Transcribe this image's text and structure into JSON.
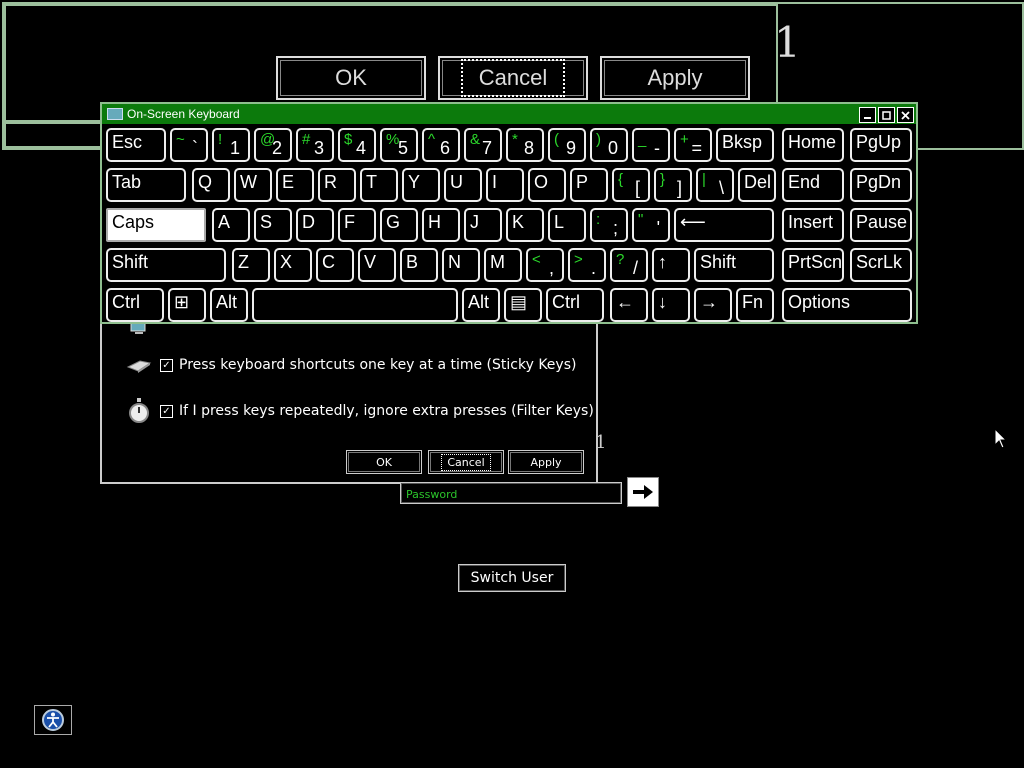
{
  "magnified_dialog": {
    "digit": "1",
    "ok_label": "OK",
    "cancel_label": "Cancel",
    "apply_label": "Apply"
  },
  "osk": {
    "title": "On-Screen Keyboard",
    "rows": [
      [
        {
          "id": "esc",
          "label": "Esc"
        },
        {
          "id": "backtick",
          "shift": "~",
          "base": "`"
        },
        {
          "id": "1",
          "shift": "!",
          "base": "1"
        },
        {
          "id": "2",
          "shift": "@",
          "base": "2"
        },
        {
          "id": "3",
          "shift": "#",
          "base": "3"
        },
        {
          "id": "4",
          "shift": "$",
          "base": "4"
        },
        {
          "id": "5",
          "shift": "%",
          "base": "5"
        },
        {
          "id": "6",
          "shift": "^",
          "base": "6"
        },
        {
          "id": "7",
          "shift": "&",
          "base": "7"
        },
        {
          "id": "8",
          "shift": "*",
          "base": "8"
        },
        {
          "id": "9",
          "shift": "(",
          "base": "9"
        },
        {
          "id": "0",
          "shift": ")",
          "base": "0"
        },
        {
          "id": "minus",
          "shift": "_",
          "base": "-"
        },
        {
          "id": "equals",
          "shift": "+",
          "base": "="
        },
        {
          "id": "bksp",
          "label": "Bksp"
        },
        {
          "id": "home",
          "label": "Home"
        },
        {
          "id": "pgup",
          "label": "PgUp"
        }
      ],
      [
        {
          "id": "tab",
          "label": "Tab"
        },
        {
          "id": "q",
          "label": "Q"
        },
        {
          "id": "w",
          "label": "W"
        },
        {
          "id": "e",
          "label": "E"
        },
        {
          "id": "r",
          "label": "R"
        },
        {
          "id": "t",
          "label": "T"
        },
        {
          "id": "y",
          "label": "Y"
        },
        {
          "id": "u",
          "label": "U"
        },
        {
          "id": "i",
          "label": "I"
        },
        {
          "id": "o",
          "label": "O"
        },
        {
          "id": "p",
          "label": "P"
        },
        {
          "id": "lbracket",
          "shift": "{",
          "base": "["
        },
        {
          "id": "rbracket",
          "shift": "}",
          "base": "]"
        },
        {
          "id": "backslash",
          "shift": "|",
          "base": "\\"
        },
        {
          "id": "del",
          "label": "Del"
        },
        {
          "id": "end",
          "label": "End"
        },
        {
          "id": "pgdn",
          "label": "PgDn"
        }
      ],
      [
        {
          "id": "caps",
          "label": "Caps"
        },
        {
          "id": "a",
          "label": "A"
        },
        {
          "id": "s",
          "label": "S"
        },
        {
          "id": "d",
          "label": "D"
        },
        {
          "id": "f",
          "label": "F"
        },
        {
          "id": "g",
          "label": "G"
        },
        {
          "id": "h",
          "label": "H"
        },
        {
          "id": "j",
          "label": "J"
        },
        {
          "id": "k",
          "label": "K"
        },
        {
          "id": "l",
          "label": "L"
        },
        {
          "id": "semicolon",
          "shift": ":",
          "base": ";"
        },
        {
          "id": "quote",
          "shift": "\"",
          "base": "'"
        },
        {
          "id": "enter",
          "label": "⟵"
        },
        {
          "id": "insert",
          "label": "Insert"
        },
        {
          "id": "pause",
          "label": "Pause"
        }
      ],
      [
        {
          "id": "lshift",
          "label": "Shift"
        },
        {
          "id": "z",
          "label": "Z"
        },
        {
          "id": "x",
          "label": "X"
        },
        {
          "id": "c",
          "label": "C"
        },
        {
          "id": "v",
          "label": "V"
        },
        {
          "id": "b",
          "label": "B"
        },
        {
          "id": "n",
          "label": "N"
        },
        {
          "id": "m",
          "label": "M"
        },
        {
          "id": "comma",
          "shift": "<",
          "base": ","
        },
        {
          "id": "period",
          "shift": ">",
          "base": "."
        },
        {
          "id": "slash",
          "shift": "?",
          "base": "/"
        },
        {
          "id": "up",
          "label": "↑"
        },
        {
          "id": "rshift",
          "label": "Shift"
        },
        {
          "id": "prtscn",
          "label": "PrtScn"
        },
        {
          "id": "scrlk",
          "label": "ScrLk"
        }
      ],
      [
        {
          "id": "lctrl",
          "label": "Ctrl"
        },
        {
          "id": "win",
          "label": "⊞"
        },
        {
          "id": "lalt",
          "label": "Alt"
        },
        {
          "id": "space",
          "label": ""
        },
        {
          "id": "ralt",
          "label": "Alt"
        },
        {
          "id": "menu",
          "label": "▤"
        },
        {
          "id": "rctrl",
          "label": "Ctrl"
        },
        {
          "id": "left",
          "label": "←"
        },
        {
          "id": "down",
          "label": "↓"
        },
        {
          "id": "right",
          "label": "→"
        },
        {
          "id": "fn",
          "label": "Fn"
        },
        {
          "id": "options",
          "label": "Options"
        }
      ]
    ]
  },
  "ease_dialog": {
    "sticky_label": "Press keyboard shortcuts one key at a time (Sticky Keys)",
    "filter_label": "If I press keys repeatedly, ignore extra presses (Filter Keys)",
    "ok_label": "OK",
    "cancel_label": "Cancel",
    "apply_label": "Apply",
    "stray_digit": "1"
  },
  "login": {
    "password_placeholder": "Password",
    "switch_user_label": "Switch User"
  },
  "colors": {
    "title_bar": "#0c7a0c",
    "accent_green": "#2bd82b",
    "border_green": "#8fbf8f"
  }
}
